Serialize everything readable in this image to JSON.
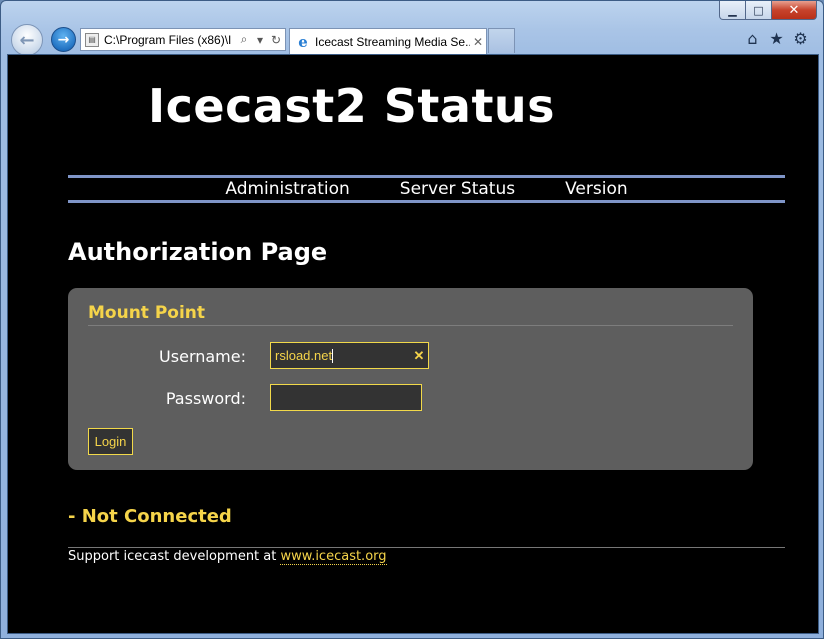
{
  "browser": {
    "address_url": "C:\\Program Files (x86)\\I",
    "tab_title": "Icecast Streaming Media Se...",
    "window_controls": {
      "minimize": "▁",
      "maximize": "□",
      "close": "✕"
    },
    "toolbar_icons": [
      "home-icon",
      "star-icon",
      "gear-icon"
    ]
  },
  "page": {
    "site_title": "Icecast2 Status",
    "nav": [
      "Administration",
      "Server Status",
      "Version"
    ],
    "heading": "Authorization Page",
    "panel": {
      "title": "Mount Point",
      "username_label": "Username:",
      "username_value": "rsload.net",
      "password_label": "Password:",
      "password_value": "",
      "login_label": "Login"
    },
    "status": "- Not Connected",
    "footer_text": "Support icecast development at ",
    "footer_link": "www.icecast.org"
  },
  "colors": {
    "accent": "#f5d44a",
    "nav_rule": "#7f95c8",
    "panel_bg": "#5e5e5e",
    "page_bg": "#000000"
  }
}
